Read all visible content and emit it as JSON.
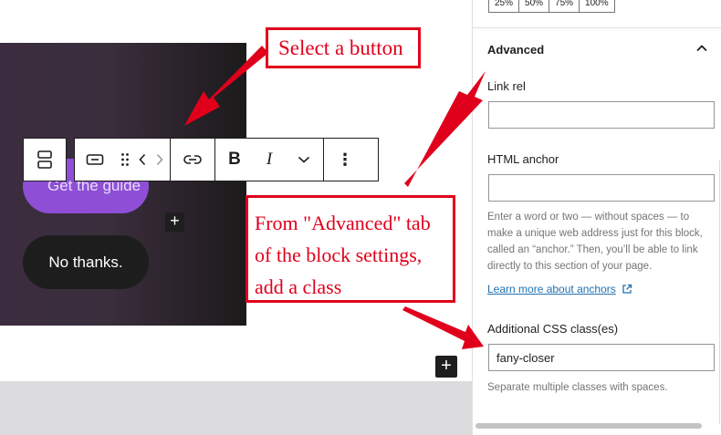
{
  "canvas": {
    "primary_button_label": "Get the guide",
    "secondary_button_label": "No thanks.",
    "inline_add_symbol": "+",
    "canvas_add_symbol": "+"
  },
  "toolbar": {
    "icons": [
      "block-parent-icon",
      "button-block-icon",
      "drag-handle-icon",
      "move-left-icon",
      "move-right-icon",
      "link-icon",
      "bold-icon",
      "italic-icon",
      "more-formatting-chevron-icon",
      "options-kebab-icon"
    ],
    "bold_label": "B",
    "italic_label": "I",
    "kebab_label": "⋮"
  },
  "sidebar": {
    "width_options": [
      "25%",
      "50%",
      "75%",
      "100%"
    ],
    "advanced_panel": {
      "title": "Advanced",
      "expanded": true,
      "link_rel": {
        "label": "Link rel",
        "value": ""
      },
      "html_anchor": {
        "label": "HTML anchor",
        "value": "",
        "help": "Enter a word or two — without spaces — to make a unique web address just for this block, called an “anchor.” Then, you’ll be able to link directly to this section of your page.",
        "link_text": "Learn more about anchors"
      },
      "css_classes": {
        "label": "Additional CSS class(es)",
        "value": "fany-closer",
        "help": "Separate multiple classes with spaces."
      }
    }
  },
  "annotations": {
    "callout_select": "Select a button",
    "callout_advanced_lines": [
      "From \"Advanced\" tab",
      "of the block settings,",
      "add a class"
    ],
    "color": "#e0001b"
  },
  "colors": {
    "primary_button": "#8e4fd6",
    "secondary_button": "#1d1d1d",
    "link": "#2271b1"
  }
}
